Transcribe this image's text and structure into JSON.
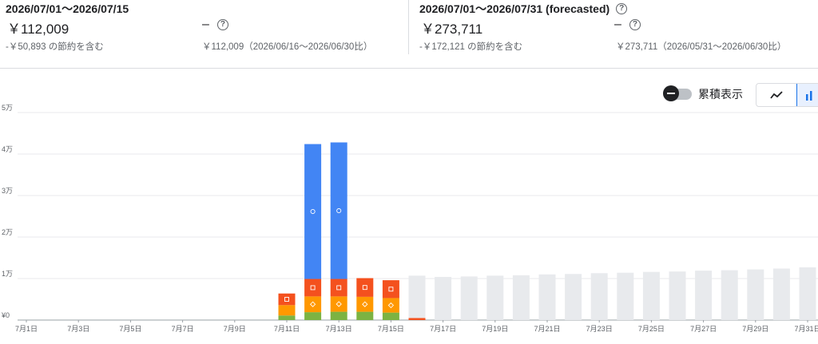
{
  "summary": {
    "current": {
      "period": "2026/07/01～2026/07/15",
      "amount": "￥112,009",
      "savings": "-￥50,893 の節約を含む",
      "trend_value": "–",
      "comparison": "￥112,009（2026/06/16～2026/06/30比）"
    },
    "forecast": {
      "period": "2026/07/01～2026/07/31 (forecasted)",
      "amount": "￥273,711",
      "savings": "-￥172,121 の節約を含む",
      "trend_value": "–",
      "comparison": "￥273,711（2026/05/31～2026/06/30比）"
    }
  },
  "controls": {
    "cumulative_label": "累積表示",
    "cumulative_on": false,
    "chart_type_buttons": [
      {
        "icon": "line-chart-icon",
        "active": false
      },
      {
        "icon": "bar-chart-icon",
        "active": true
      }
    ]
  },
  "colors": {
    "blue": "#4285f4",
    "red": "#f4511e",
    "orange": "#ff9800",
    "green": "#7cb342",
    "forecast": "#e8eaed",
    "grid": "#e8eaed"
  },
  "chart_data": {
    "type": "bar",
    "stacked": true,
    "y_ticks": [
      "¥0",
      "1万",
      "2万",
      "3万",
      "4万",
      "5万"
    ],
    "ylim": [
      0,
      50000
    ],
    "x_tick_labels": [
      "7月1日",
      "7月3日",
      "7月5日",
      "7月7日",
      "7月9日",
      "7月11日",
      "7月13日",
      "7月15日",
      "7月17日",
      "7月19日",
      "7月21日",
      "7月23日",
      "7月25日",
      "7月27日",
      "7月29日",
      "7月31日"
    ],
    "categories": [
      "7/1",
      "7/2",
      "7/3",
      "7/4",
      "7/5",
      "7/6",
      "7/7",
      "7/8",
      "7/9",
      "7/10",
      "7/11",
      "7/12",
      "7/13",
      "7/14",
      "7/15",
      "7/16",
      "7/17",
      "7/18",
      "7/19",
      "7/20",
      "7/21",
      "7/22",
      "7/23",
      "7/24",
      "7/25",
      "7/26",
      "7/27",
      "7/28",
      "7/29",
      "7/30",
      "7/31"
    ],
    "series": [
      {
        "color": "#7cb342",
        "values": [
          0,
          0,
          0,
          0,
          0,
          0,
          0,
          0,
          0,
          0,
          1100,
          1900,
          2000,
          2000,
          1800,
          0,
          0,
          0,
          0,
          0,
          0,
          0,
          0,
          0,
          0,
          0,
          0,
          0,
          0,
          0,
          0
        ]
      },
      {
        "color": "#ff9800",
        "values": [
          0,
          0,
          0,
          0,
          0,
          0,
          0,
          0,
          0,
          0,
          2500,
          3800,
          3700,
          3600,
          3500,
          0,
          0,
          0,
          0,
          0,
          0,
          0,
          0,
          0,
          0,
          0,
          0,
          0,
          0,
          0,
          0
        ]
      },
      {
        "color": "#f4511e",
        "values": [
          0,
          0,
          0,
          0,
          0,
          0,
          0,
          0,
          0,
          0,
          2800,
          4200,
          4200,
          4500,
          4300,
          500,
          0,
          0,
          0,
          0,
          0,
          0,
          0,
          0,
          0,
          0,
          0,
          0,
          0,
          0,
          0
        ]
      },
      {
        "color": "#4285f4",
        "values": [
          0,
          0,
          0,
          0,
          0,
          0,
          0,
          0,
          0,
          0,
          0,
          32500,
          32900,
          0,
          0,
          0,
          0,
          0,
          0,
          0,
          0,
          0,
          0,
          0,
          0,
          0,
          0,
          0,
          0,
          0,
          0
        ]
      },
      {
        "color": "#e8eaed",
        "forecast": true,
        "values": [
          0,
          0,
          0,
          0,
          0,
          0,
          0,
          0,
          0,
          0,
          0,
          0,
          0,
          0,
          0,
          10200,
          10400,
          10500,
          10700,
          10800,
          11000,
          11100,
          11300,
          11400,
          11600,
          11700,
          11900,
          12000,
          12200,
          12400,
          12700
        ]
      }
    ]
  }
}
